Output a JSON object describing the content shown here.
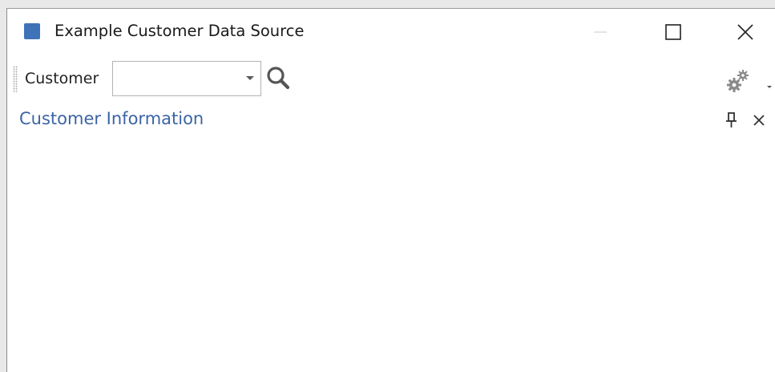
{
  "window": {
    "title": "Example Customer Data Source",
    "icon": "app-icon",
    "controls": [
      "minimize-icon",
      "maximize-icon",
      "close-icon"
    ]
  },
  "toolbar": {
    "customer_label": "Customer",
    "customer_value": "",
    "search_icon": "search-icon",
    "settings_icon": "gear-icon"
  },
  "panel": {
    "title": "Customer Information",
    "pin_icon": "pin-icon",
    "close_icon": "close-icon"
  },
  "colors": {
    "accent": "#3f73b8",
    "panel_title": "#3c64a6"
  }
}
